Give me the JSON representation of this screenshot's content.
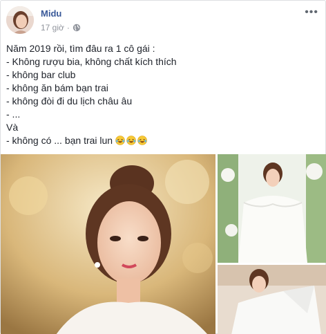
{
  "post": {
    "author": "Midu",
    "time": "17 giờ",
    "separator": "·",
    "more_label": "•••",
    "privacy_icon": "globe-icon",
    "lines": [
      "Năm 2019 rồi, tìm đâu ra 1 cô gái :",
      "- Không rượu bia, không chất kích thích",
      "- không bar club",
      "- không ăn bám bạn trai",
      "- không đòi đi du lịch châu âu",
      "- ...",
      "Và",
      "- không có ... bạn trai lun"
    ],
    "emoji_icon": "laughing-tears-emoji",
    "emoji_count": 3
  },
  "colors": {
    "author": "#385898",
    "meta": "#90949c",
    "text": "#1d2129",
    "border": "#dddfe2"
  },
  "photos": [
    {
      "name": "photo-portrait"
    },
    {
      "name": "photo-white-dress"
    },
    {
      "name": "photo-white-dress-closeup"
    }
  ]
}
